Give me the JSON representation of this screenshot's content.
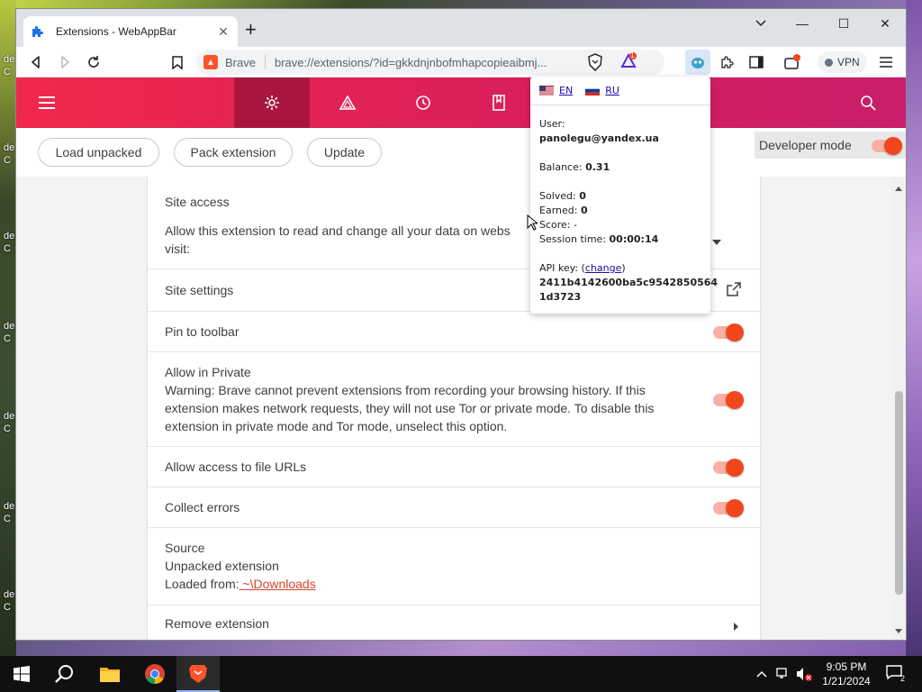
{
  "tab": {
    "title": "Extensions - WebAppBar",
    "close": "✕"
  },
  "window_controls": {
    "minimize": "—",
    "maximize": "☐",
    "close": "✕"
  },
  "address_bar": {
    "site_label": "Brave",
    "url": "brave://extensions/?id=gkkdnjnbofmhapcopieaibmj...",
    "rewards_badge": "1"
  },
  "toolbar": {
    "vpn_label": "VPN"
  },
  "subheader": {
    "load_unpacked": "Load unpacked",
    "pack_extension": "Pack extension",
    "update": "Update",
    "developer_mode": "Developer mode"
  },
  "details": {
    "site_access_title": "Site access",
    "site_access_desc_1": "Allow this extension to read and change all your data on webs",
    "site_access_desc_2": "visit:",
    "site_settings": "Site settings",
    "pin_to_toolbar": "Pin to toolbar",
    "allow_private_title": "Allow in Private",
    "allow_private_warning_1": "Warning: Brave cannot prevent extensions from recording your browsing history. If this",
    "allow_private_warning_2": "extension makes network requests, they will not use Tor or private mode. To disable this",
    "allow_private_warning_3": "extension in private mode and Tor mode, unselect this option.",
    "allow_file_urls": "Allow access to file URLs",
    "collect_errors": "Collect errors",
    "source_title": "Source",
    "source_type": "Unpacked extension",
    "loaded_from_label": "Loaded from:",
    "loaded_from_path": " ~\\Downloads",
    "remove_extension": "Remove extension"
  },
  "popup": {
    "lang_en": "EN",
    "lang_ru": "RU",
    "user_label": "User:",
    "user_email": "panolegu@yandex.ua",
    "balance_label": "Balance:",
    "balance_value": "0.31",
    "solved_label": "Solved:",
    "solved_value": "0",
    "earned_label": "Earned:",
    "earned_value": "0",
    "score_label": "Score:",
    "score_value": "-",
    "session_label": "Session time:",
    "session_value": "00:00:14",
    "api_key_label": "API key: (",
    "api_key_change": "change",
    "api_key_close": ")",
    "api_key_1": "2411b4142600ba5c9542850564",
    "api_key_2": "1d3723"
  },
  "taskbar": {
    "time": "9:05 PM",
    "date": "1/21/2024",
    "notification_count": "2"
  },
  "desktop": {
    "icon_labels": [
      "de",
      "C",
      "de",
      "C",
      "de",
      "C",
      "de",
      "C",
      "de",
      "C",
      "de",
      "C",
      "de",
      "C"
    ]
  },
  "colors": {
    "brave_accent": "#f1461e",
    "header_gradient_start": "#f0284b",
    "header_gradient_end": "#c81e6b"
  }
}
